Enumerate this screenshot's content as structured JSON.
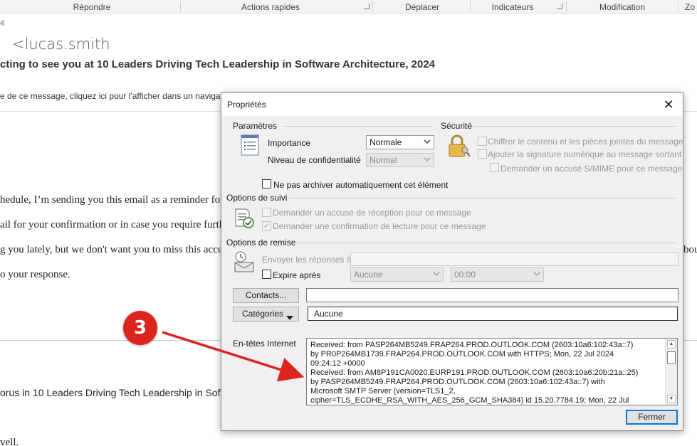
{
  "ribbon": {
    "groups": [
      "Répondre",
      "Actions rapides",
      "Déplacer",
      "Indicateurs",
      "Modification",
      "Zo"
    ]
  },
  "email": {
    "date_fragment": "4",
    "sender": "<lucas.smith",
    "subject": "cting to see you at 10 Leaders Driving Tech Leadership in Software Architecture, 2024",
    "infobar": "e de ce message, cliquez ici pour l'afficher dans un navigat",
    "body_lines": [
      "hedule, I’m sending you this email as a reminder for y",
      "ail for your confirmation or in case you require furthe",
      "g you lately, but we don't want you to miss this access",
      "o your response."
    ],
    "body_right_fragment": "bou",
    "lower_lines": [
      "orus in 10 Leaders Driving Tech Leadership in Softwa",
      "vell."
    ]
  },
  "dialog": {
    "title": "Propriétés",
    "close_glyph": "✕",
    "parametres": {
      "heading": "Paramètres",
      "importance_label": "Importance",
      "importance_value": "Normale",
      "confidentiality_label": "Niveau de confidentialité",
      "confidentiality_value": "Normal",
      "no_archive_label": "Ne pas archiver automatiquement cet élément"
    },
    "securite": {
      "heading": "Sécurité",
      "encrypt_label": "Chiffrer le contenu et les pièces jointes du message",
      "signature_label": "Ajouter la signature numérique au message sortant",
      "smime_label": "Demander un accusé S/MIME pour ce message"
    },
    "suivi": {
      "heading": "Options de suivi",
      "delivery_receipt_label": "Demander un accusé de réception pour ce message",
      "read_receipt_label": "Demander une confirmation de lecture pour ce message",
      "read_receipt_checked": true
    },
    "remise": {
      "heading": "Options de remise",
      "reply_to_label": "Envoyer les réponses à",
      "reply_to_value": "",
      "expires_label": "Expire après",
      "expires_date": "Aucune",
      "expires_time": "00:00"
    },
    "contacts_button": "Contacts...",
    "contacts_value": "",
    "categories_button": "Catégories",
    "categories_value": "Aucune",
    "headers_label": "En-têtes Internet",
    "headers_lines": [
      "Received: from PASP264MB5249.FRAP264.PROD.OUTLOOK.COM (2603:10a6:102:43a::7)",
      " by PR0P264MB1739.FRAP264.PROD.OUTLOOK.COM with HTTPS; Mon, 22 Jul 2024",
      " 09:24:12 +0000",
      "Received: from AM8P191CA0020.EURP191.PROD.OUTLOOK.COM (2603:10a6:20b:21a::25)",
      " by PASP264MB5249.FRAP264.PROD.OUTLOOK.COM (2603:10a6:102:43a::7) with",
      " Microsoft SMTP Server (version=TLS1_2,",
      " cipher=TLS_ECDHE_RSA_WITH_AES_256_GCM_SHA384) id 15.20.7784.19; Mon, 22 Jul"
    ],
    "close_button": "Fermer"
  },
  "annotation": {
    "badge_number": "3",
    "color": "#dd2520"
  },
  "colors": {
    "accent": "#0078d7",
    "annotation_red": "#dd2520"
  }
}
